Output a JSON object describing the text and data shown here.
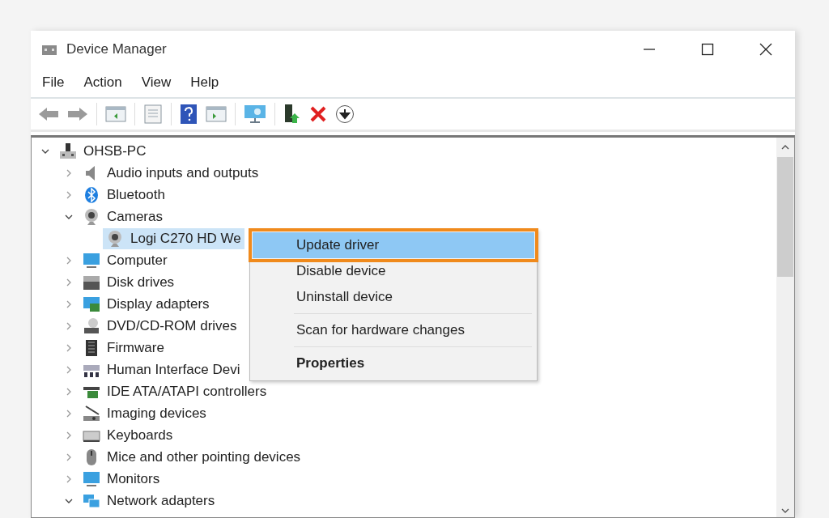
{
  "window": {
    "title": "Device Manager"
  },
  "menu_bar": [
    "File",
    "Action",
    "View",
    "Help"
  ],
  "tree": [
    {
      "label": "OHSB-PC",
      "expanded": true,
      "selected": false,
      "children": [
        {
          "label": "Audio inputs and outputs",
          "expanded": false,
          "selected": false
        },
        {
          "label": "Bluetooth",
          "expanded": false,
          "selected": false
        },
        {
          "label": "Cameras",
          "expanded": true,
          "selected": false,
          "children": [
            {
              "label": "Logi C270 HD We",
              "selected": true
            }
          ]
        },
        {
          "label": "Computer",
          "expanded": false,
          "selected": false
        },
        {
          "label": "Disk drives",
          "expanded": false,
          "selected": false
        },
        {
          "label": "Display adapters",
          "expanded": false,
          "selected": false
        },
        {
          "label": "DVD/CD-ROM drives",
          "expanded": false,
          "selected": false
        },
        {
          "label": "Firmware",
          "expanded": false,
          "selected": false
        },
        {
          "label": "Human Interface Devi",
          "expanded": false,
          "selected": false
        },
        {
          "label": "IDE ATA/ATAPI controllers",
          "expanded": false,
          "selected": false
        },
        {
          "label": "Imaging devices",
          "expanded": false,
          "selected": false
        },
        {
          "label": "Keyboards",
          "expanded": false,
          "selected": false
        },
        {
          "label": "Mice and other pointing devices",
          "expanded": false,
          "selected": false
        },
        {
          "label": "Monitors",
          "expanded": false,
          "selected": false
        },
        {
          "label": "Network adapters",
          "expanded": true,
          "selected": false
        }
      ]
    }
  ],
  "context_menu": [
    {
      "label": "Update driver",
      "selected": true,
      "default": false,
      "separator_before": false
    },
    {
      "label": "Disable device",
      "selected": false,
      "default": false,
      "separator_before": false
    },
    {
      "label": "Uninstall device",
      "selected": false,
      "default": false,
      "separator_before": false
    },
    {
      "label": "Scan for hardware changes",
      "selected": false,
      "default": false,
      "separator_before": true
    },
    {
      "label": "Properties",
      "selected": false,
      "default": true,
      "separator_before": true
    }
  ]
}
